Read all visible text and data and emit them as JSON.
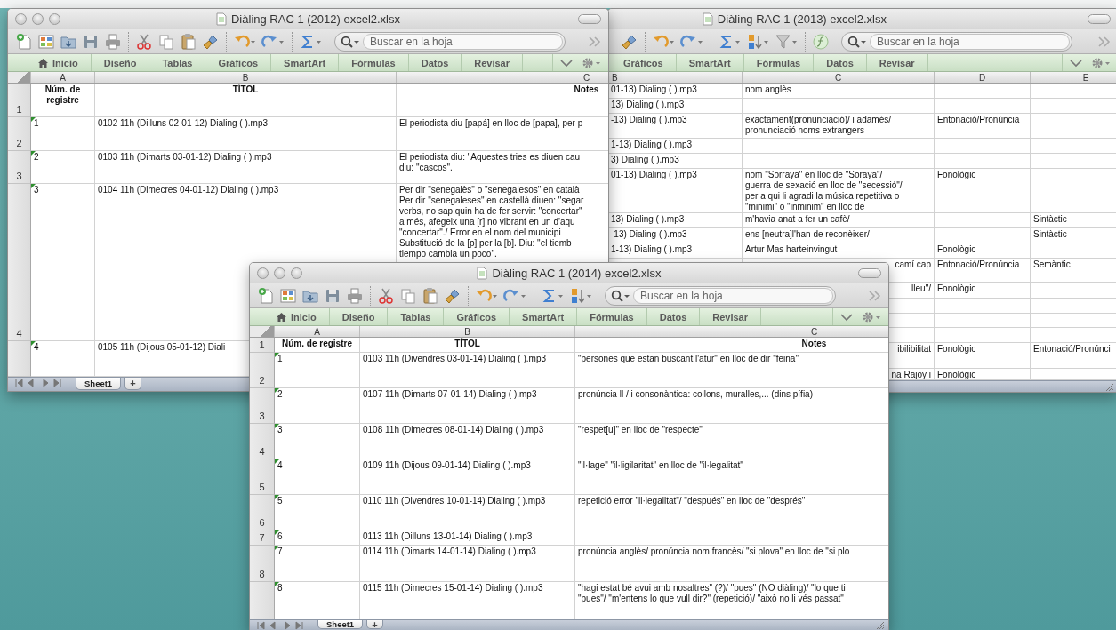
{
  "windows": [
    {
      "title": "Diàling RAC 1 (2012) excel2.xlsx",
      "window_buttons": true,
      "toolbar": [
        {
          "kind": "new"
        },
        {
          "kind": "gallery"
        },
        {
          "kind": "open"
        },
        {
          "kind": "save"
        },
        {
          "kind": "print"
        },
        {
          "kind": "separator"
        },
        {
          "kind": "cut"
        },
        {
          "kind": "copy"
        },
        {
          "kind": "paste"
        },
        {
          "kind": "brush"
        },
        {
          "kind": "separator"
        },
        {
          "kind": "undo"
        },
        {
          "kind": "redo"
        },
        {
          "kind": "separator"
        },
        {
          "kind": "sum"
        }
      ],
      "search": {
        "placeholder": "Buscar en la hoja"
      },
      "ribbon_tabs": [
        {
          "label": "Inicio",
          "kind": "home"
        },
        {
          "label": "Diseño",
          "kind": "plain"
        },
        {
          "label": "Tablas",
          "kind": "plain"
        },
        {
          "label": "Gráficos",
          "kind": "plain"
        },
        {
          "label": "SmartArt",
          "kind": "plain"
        },
        {
          "label": "Fórmulas",
          "kind": "plain"
        },
        {
          "label": "Datos",
          "kind": "plain"
        },
        {
          "label": "Revisar",
          "kind": "plain"
        }
      ],
      "columns": [
        "A",
        "B",
        "C"
      ],
      "rows": [
        {
          "n": "1",
          "header": true,
          "marked": false,
          "cells": [
            "Núm. de registre",
            "TÍTOL",
            "Notes"
          ]
        },
        {
          "n": "2",
          "header": false,
          "marked": true,
          "cells": [
            "1",
            "0102 11h (Dilluns 02-01-12) Dialing ( ).mp3",
            "El periodista diu [papá] en lloc de [papa], per p"
          ]
        },
        {
          "n": "3",
          "header": false,
          "marked": true,
          "cells": [
            "2",
            "0103 11h (Dimarts 03-01-12) Dialing ( ).mp3",
            "El periodista diu: \"Aquestes tries es diuen cau\ndiu: \"cascos\"."
          ]
        },
        {
          "n": "4",
          "header": false,
          "marked": true,
          "cells": [
            "3",
            "0104 11h (Dimecres 04-01-12) Dialing ( ).mp3",
            "Per dir \"senegalès\" o \"senegalesos\" en català\nPer dir \"senegaleses\" en castellà diuen: \"segar\nverbs, no sap quin ha de fer servir: \"concertar\"\na més, afegeix una [r] no vibrant en un d'aqu\n\"concertar\"./ Error en el nom del municipi\nSubstitució de la [p] per la [b]. Diu: \"el tiemb\ntiempo cambia un poco\"."
          ]
        },
        {
          "header": false,
          "marked": true,
          "cells": [
            "4",
            "0105 11h (Dijous 05-01-12) Diali",
            null
          ]
        }
      ],
      "sheet_tabs": [
        {
          "label": "Sheet1",
          "selected": true
        }
      ],
      "add_sheet": "+"
    },
    {
      "title": "Diàling RAC 1 (2013) excel2.xlsx",
      "window_buttons": false,
      "toolbar": [
        {
          "kind": "brush"
        },
        {
          "kind": "separator"
        },
        {
          "kind": "undo"
        },
        {
          "kind": "redo"
        },
        {
          "kind": "separator"
        },
        {
          "kind": "sum"
        },
        {
          "kind": "sort"
        },
        {
          "kind": "filter"
        },
        {
          "kind": "separator"
        },
        {
          "kind": "formula"
        }
      ],
      "search": {
        "placeholder": "Buscar en la hoja"
      },
      "ribbon_tabs": [
        {
          "label": "Gráficos",
          "kind": "plain"
        },
        {
          "label": "SmartArt",
          "kind": "plain"
        },
        {
          "label": "Fórmulas",
          "kind": "plain"
        },
        {
          "label": "Datos",
          "kind": "plain"
        },
        {
          "label": "Revisar",
          "kind": "plain"
        }
      ],
      "columns": [
        "B",
        "C",
        "D",
        "E"
      ],
      "rows": [
        {
          "marked": false,
          "cells": [
            "01-13) Dialing ( ).mp3",
            "nom anglès",
            null,
            null
          ]
        },
        {
          "marked": false,
          "cells": [
            "13) Dialing ( ).mp3",
            null,
            null,
            null
          ]
        },
        {
          "marked": false,
          "cells": [
            "-13) Dialing ( ).mp3",
            "exactament(pronunciació)/ i adamés/\npronunciació noms extrangers",
            "Entonació/Pronúncia",
            null
          ]
        },
        {
          "marked": false,
          "cells": [
            "1-13) Dialing ( ).mp3",
            null,
            null,
            null
          ]
        },
        {
          "marked": false,
          "cells": [
            "3) Dialing ( ).mp3",
            null,
            null,
            null
          ]
        },
        {
          "marked": false,
          "cells": [
            "01-13) Dialing ( ).mp3",
            "nom \"Sorraya\" en lloc de \"Soraya\"/\nguerra de sexació en lloc de \"secessió\"/\nper a qui li agradi la música repetitiva o\n\"minimi\" o \"inminim\" en lloc de",
            "Fonològic",
            null
          ]
        },
        {
          "marked": false,
          "cells": [
            "13) Dialing ( ).mp3",
            "m'havia anat a fer un cafè/",
            null,
            "Sintàctic"
          ]
        },
        {
          "marked": false,
          "cells": [
            "-13) Dialing ( ).mp3",
            "ens [neutra]l'han de reconèixer/",
            null,
            "Sintàctic"
          ]
        },
        {
          "marked": false,
          "cells": [
            "1-13) Dialing ( ).mp3",
            "Artur Mas harteinvingut",
            "Fonològic",
            null
          ]
        },
        {
          "marked": false,
          "cells": [
            null,
            "camí cap",
            "Entonació/Pronúncia",
            "Semàntic"
          ]
        },
        {
          "marked": false,
          "cells": [
            null,
            "lleu\"/",
            "Fonològic",
            null
          ]
        },
        {
          "marked": false,
          "cells": [
            null,
            null,
            null,
            null
          ]
        },
        {
          "marked": false,
          "cells": [
            null,
            null,
            null,
            null
          ]
        },
        {
          "marked": false,
          "cells": [
            null,
            null,
            null,
            null
          ]
        },
        {
          "marked": false,
          "cells": [
            null,
            "ibilibilitat",
            "Fonològic",
            "Entonació/Pronúnci"
          ]
        },
        {
          "marked": false,
          "cells": [
            null,
            "na Rajoy i",
            "Fonològic",
            null
          ]
        }
      ]
    },
    {
      "title": "Diàling RAC 1 (2014) excel2.xlsx",
      "window_buttons": true,
      "toolbar": [
        {
          "kind": "new"
        },
        {
          "kind": "gallery"
        },
        {
          "kind": "open"
        },
        {
          "kind": "save"
        },
        {
          "kind": "print"
        },
        {
          "kind": "separator"
        },
        {
          "kind": "cut"
        },
        {
          "kind": "copy"
        },
        {
          "kind": "paste"
        },
        {
          "kind": "brush"
        },
        {
          "kind": "separator"
        },
        {
          "kind": "undo"
        },
        {
          "kind": "redo"
        },
        {
          "kind": "separator"
        },
        {
          "kind": "sum"
        },
        {
          "kind": "sort"
        }
      ],
      "search": {
        "placeholder": "Buscar en la hoja"
      },
      "ribbon_tabs": [
        {
          "label": "Inicio",
          "kind": "home"
        },
        {
          "label": "Diseño",
          "kind": "plain"
        },
        {
          "label": "Tablas",
          "kind": "plain"
        },
        {
          "label": "Gráficos",
          "kind": "plain"
        },
        {
          "label": "SmartArt",
          "kind": "plain"
        },
        {
          "label": "Fórmulas",
          "kind": "plain"
        },
        {
          "label": "Datos",
          "kind": "plain"
        },
        {
          "label": "Revisar",
          "kind": "plain"
        }
      ],
      "columns": [
        "A",
        "B",
        "C"
      ],
      "rows": [
        {
          "n": "1",
          "header": true,
          "marked": false,
          "cells": [
            "Núm. de registre",
            "TÍTOL",
            "Notes"
          ]
        },
        {
          "n": "2",
          "header": false,
          "marked": true,
          "cells": [
            "1",
            "0103 11h (Divendres 03-01-14) Dialing ( ).mp3",
            "\"persones que estan buscant l'atur\" en lloc de dir \"feina\""
          ]
        },
        {
          "n": "3",
          "header": false,
          "marked": true,
          "cells": [
            "2",
            "0107 11h (Dimarts 07-01-14) Dialing ( ).mp3",
            "pronúncia ll / i consonàntica: collons, muralles,... (dins pífia)"
          ]
        },
        {
          "n": "4",
          "header": false,
          "marked": true,
          "cells": [
            "3",
            "0108 11h (Dimecres 08-01-14) Dialing ( ).mp3",
            "\"respet[u]\" en lloc de \"respecte\""
          ]
        },
        {
          "n": "5",
          "header": false,
          "marked": true,
          "cells": [
            "4",
            "0109 11h (Dijous 09-01-14) Dialing ( ).mp3",
            "\"il·lage\" \"il·ligilaritat\" en lloc de \"il·legalitat\""
          ]
        },
        {
          "n": "6",
          "header": false,
          "marked": true,
          "cells": [
            "5",
            "0110 11h (Divendres 10-01-14) Dialing ( ).mp3",
            "repetició error \"il·legalitat\"/ \"después\" en lloc de \"després\""
          ]
        },
        {
          "n": "7",
          "header": false,
          "marked": true,
          "cells": [
            "6",
            "0113 11h (Dilluns 13-01-14) Dialing ( ).mp3",
            null
          ]
        },
        {
          "n": "8",
          "header": false,
          "marked": true,
          "cells": [
            "7",
            "0114 11h (Dimarts 14-01-14) Dialing ( ).mp3",
            "pronúncia anglès/ pronúncia nom francès/ \"si plova\" en lloc de \"si plo"
          ]
        },
        {
          "header": false,
          "marked": true,
          "cells": [
            "8",
            "0115 11h (Dimecres 15-01-14) Dialing ( ).mp3",
            "\"hagi estat bé avui amb nosaltres\" (?)/ \"pues\" (NO diàling)/ \"lo que ti\n\"pues\"/ \"m'entens lo que vull dir?\" (repetició)/ \"això no li vés passat\""
          ]
        }
      ],
      "sheet_tabs": [
        {
          "label": "Sheet1",
          "selected": true
        }
      ],
      "add_sheet": "+"
    }
  ]
}
